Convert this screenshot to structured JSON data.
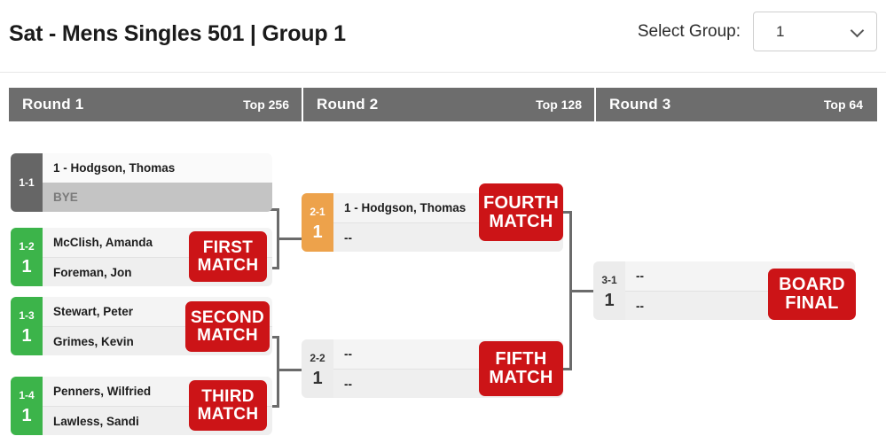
{
  "header": {
    "title": "Sat - Mens Singles 501 | Group 1",
    "group_label": "Select Group:",
    "group_value": "1",
    "chevron_icon": "chevron-down-icon"
  },
  "rounds": [
    {
      "name": "Round 1",
      "top": "Top 256"
    },
    {
      "name": "Round 2",
      "top": "Top 128"
    },
    {
      "name": "Round 3",
      "top": "Top 64"
    }
  ],
  "colors": {
    "green": "#3cb44a",
    "orange": "#eda24b",
    "dark_gray": "#666666",
    "light_gray": "#ececec",
    "red": "#cc1417",
    "header_gray": "#6d6d6d"
  },
  "matches": {
    "m11": {
      "id": "1-1",
      "score": "",
      "p1": "1 - Hodgson, Thomas",
      "p2": "BYE",
      "tag1": "",
      "tag2": ""
    },
    "m12": {
      "id": "1-2",
      "score": "1",
      "p1": "McClish, Amanda",
      "p2": "Foreman, Jon",
      "tag1": "FIRST",
      "tag2": "MATCH"
    },
    "m13": {
      "id": "1-3",
      "score": "1",
      "p1": "Stewart, Peter",
      "p2": "Grimes, Kevin",
      "tag1": "SECOND",
      "tag2": "MATCH"
    },
    "m14": {
      "id": "1-4",
      "score": "1",
      "p1": "Penners, Wilfried",
      "p2": "Lawless, Sandi",
      "tag1": "THIRD",
      "tag2": "MATCH"
    },
    "m21": {
      "id": "2-1",
      "score": "1",
      "p1": "1 - Hodgson, Thomas",
      "p2": "--",
      "tag1": "FOURTH",
      "tag2": "MATCH"
    },
    "m22": {
      "id": "2-2",
      "score": "1",
      "p1": "--",
      "p2": "--",
      "tag1": "FIFTH",
      "tag2": "MATCH"
    },
    "m31": {
      "id": "3-1",
      "score": "1",
      "p1": "--",
      "p2": "--",
      "tag1": "BOARD",
      "tag2": "FINAL"
    }
  }
}
